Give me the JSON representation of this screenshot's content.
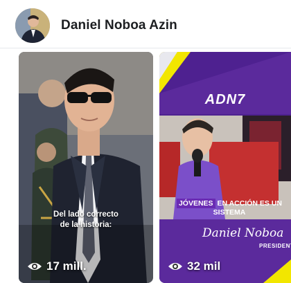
{
  "header": {
    "page_name": "Daniel Noboa Azin"
  },
  "reels": [
    {
      "caption": "Del lado correcto de la historia:",
      "views": "17 mill.",
      "view_icon": "eye-icon"
    },
    {
      "logo": "ADN7",
      "banner_line1": "JÓVENES",
      "banner_line1_rest": " EN ACCIÓN ES UN",
      "banner_line2": "SISTEMA",
      "signature": "Daniel Noboa",
      "signature_title": "PRESIDENTE",
      "views": "32 mil",
      "view_icon": "eye-icon"
    }
  ],
  "colors": {
    "accent_purple": "#5b2a9c",
    "accent_yellow": "#f2e600",
    "text_dark": "#1c1e21"
  }
}
